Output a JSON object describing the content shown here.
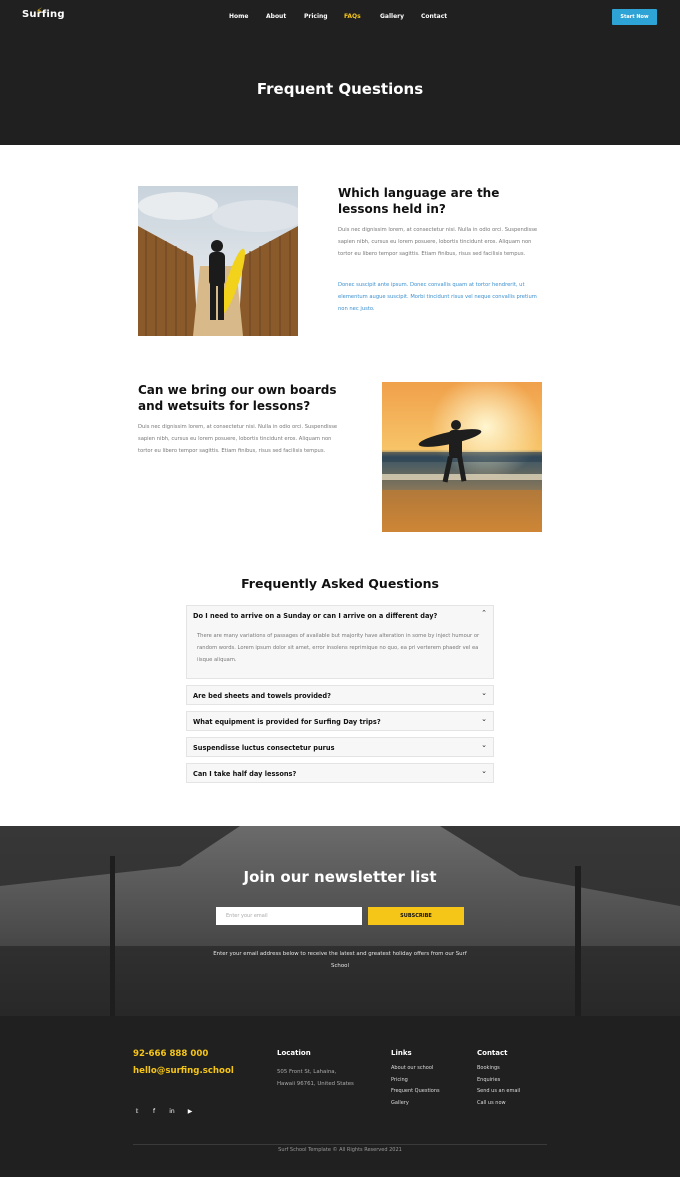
{
  "header": {
    "logo": "Surfing",
    "nav": [
      "Home",
      "About",
      "Pricing",
      "FAQs",
      "Gallery",
      "Contact"
    ],
    "active_nav": "FAQs",
    "cta": "Start Now",
    "title": "Frequent Questions"
  },
  "section1": {
    "title": "Which language are the lessons held in?",
    "text": "Duis nec dignissim lorem, at consectetur nisi. Nulla in odio orci. Suspendisse sapien nibh, cursus eu lorem posuere, lobortis tincidunt eros. Aliquam non tortor eu libero tempor sagittis. Etiam finibus, risus sed facilisis tempus.",
    "link_text": "Donec suscipit ante ipsum. Donec convallis quam at tortor hendrerit, ut elementum augue suscipit. Morbi tincidunt risus vel neque convallis pretium non nec justo."
  },
  "section2": {
    "title": "Can we bring our own boards and wetsuits for lessons?",
    "text": "Duis nec dignissim lorem, at consectetur nisi. Nulla in odio orci. Suspendisse sapien nibh, cursus eu lorem posuere, lobortis tincidunt eros. Aliquam non tortor eu libero tempor sagittis. Etiam finibus, risus sed facilisis tempus."
  },
  "faq": {
    "heading": "Frequently Asked Questions",
    "items": [
      {
        "question": "Do I need to arrive on a Sunday or can I arrive on a different day?",
        "answer": "There are many variations of passages of available but majority have alteration in some by inject humour or random words. Lorem ipsum dolor sit amet, error insolens reprimique no quo, ea pri verterem phaedr vel ea iisque aliquam.",
        "expanded": true
      },
      {
        "question": "Are bed sheets and towels provided?",
        "expanded": false
      },
      {
        "question": "What equipment is provided for Surfing Day trips?",
        "expanded": false
      },
      {
        "question": "Suspendisse luctus consectetur purus",
        "expanded": false
      },
      {
        "question": "Can I take half day lessons?",
        "expanded": false
      }
    ]
  },
  "newsletter": {
    "title": "Join our newsletter list",
    "placeholder": "Enter your email",
    "button": "SUBSCRIBE",
    "text": "Enter your email address below to receive the latest and greatest holiday offers from our Surf School"
  },
  "footer": {
    "phone": "92-666 888 000",
    "email": "hello@surfing.school",
    "location_head": "Location",
    "address_line1": "505 Front St, Lahaina,",
    "address_line2": "Hawaii 96761, United States",
    "links_head": "Links",
    "links": [
      "About our school",
      "Pricing",
      "Frequent Questions",
      "Gallery"
    ],
    "contact_head": "Contact",
    "contact_links": [
      "Bookings",
      "Enquiries",
      "Send us an email",
      "Call us now"
    ],
    "social_icons": [
      "twitter-icon",
      "facebook-icon",
      "linkedin-icon",
      "youtube-icon"
    ],
    "copyright": "Surf School Template  © All Rights Reserved 2021"
  },
  "colors": {
    "accent_yellow": "#f5c518",
    "accent_blue": "#2ea3d6",
    "dark": "#202020"
  }
}
